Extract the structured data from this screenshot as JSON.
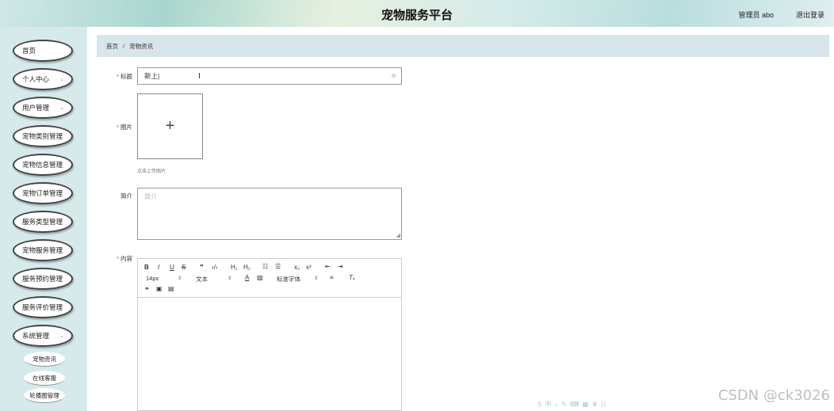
{
  "header": {
    "title": "宠物服务平台",
    "user_label": "管理员 abo",
    "logout_label": "退出登录"
  },
  "sidebar": {
    "items": [
      {
        "label": "首页",
        "has_chevron": false
      },
      {
        "label": "个人中心",
        "has_chevron": true
      },
      {
        "label": "用户管理",
        "has_chevron": true
      },
      {
        "label": "宠物类别管理",
        "has_chevron": false
      },
      {
        "label": "宠物信息管理",
        "has_chevron": false
      },
      {
        "label": "宠物订单管理",
        "has_chevron": false
      },
      {
        "label": "服务类型管理",
        "has_chevron": false
      },
      {
        "label": "宠物服务管理",
        "has_chevron": false
      },
      {
        "label": "服务预约管理",
        "has_chevron": false
      },
      {
        "label": "服务评价管理",
        "has_chevron": false
      },
      {
        "label": "系统管理",
        "has_chevron": true
      }
    ],
    "subitems": [
      {
        "label": "宠物资讯"
      },
      {
        "label": "在线客服"
      },
      {
        "label": "轮播图管理"
      }
    ]
  },
  "breadcrumb": {
    "home": "首页",
    "separator": "/",
    "current": "宠物资讯"
  },
  "form": {
    "title_label": "标题",
    "title_value": "新上|",
    "image_label": "图片",
    "upload_plus": "+",
    "upload_hint": "点击上传图片",
    "intro_label": "简介",
    "intro_placeholder": "简介",
    "content_label": "内容",
    "required_mark": "*"
  },
  "editor": {
    "font_size": "14px",
    "paragraph": "文本",
    "font_family": "标准字体"
  },
  "icons": {
    "clear": "clear-icon",
    "plus": "plus-icon",
    "chevron": "chevron-down-icon"
  },
  "watermark": {
    "toolbar_glyphs": "S 中 ♪ ✎ ⌨ ▦ ♛ ☷",
    "csdn": "CSDN @ck3026"
  }
}
